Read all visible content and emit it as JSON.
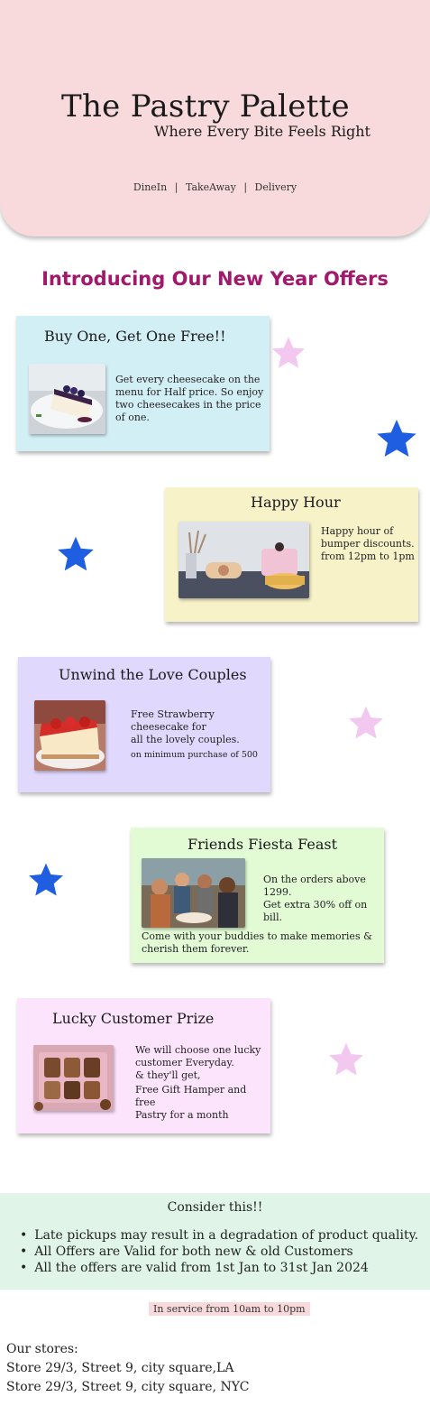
{
  "header": {
    "brand": "The Pastry Palette",
    "tagline": "Where Every Bite Feels Right",
    "services": [
      "DineIn",
      "TakeAway",
      "Delivery"
    ],
    "separator": "|",
    "background_color": "#f8dadc"
  },
  "offers": {
    "title": "Introducing Our New Year Offers",
    "title_color": "#a2196c",
    "cards": [
      {
        "title": "Buy One, Get One Free!!",
        "lines": [
          "Get every cheesecake on the",
          "menu for Half price. So enjoy",
          "two cheesecakes in the price",
          "of one."
        ],
        "image": "blueberry-cheesecake-image",
        "background": "#d3eff6"
      },
      {
        "title": "Happy Hour",
        "lines": [
          "Happy hour of",
          "bumper discounts.",
          "from 12pm to 1pm"
        ],
        "image": "cake-table-image",
        "background": "#f7f2c8"
      },
      {
        "title": "Unwind the Love Couples",
        "lines": [
          "Free Strawberry",
          "cheesecake for",
          "all the lovely couples."
        ],
        "note": "on minimum purchase of 500",
        "image": "strawberry-cheesecake-image",
        "background": "#e1d9fd"
      },
      {
        "title": "Friends Fiesta Feast",
        "lines": [
          "On the orders above",
          "1299.",
          "Get extra 30% off on",
          "bill."
        ],
        "extra_lines": [
          "Come with your buddies to make memories &",
          "cherish them forever."
        ],
        "image": "friends-dining-image",
        "background": "#e2fbd5"
      },
      {
        "title": "Lucky Customer Prize",
        "lines": [
          "We will choose one lucky",
          "customer Everyday.",
          "& they'll get,",
          "Free Gift Hamper and free",
          "Pastry for a month"
        ],
        "image": "gift-hamper-image",
        "background": "#fde4fd"
      }
    ]
  },
  "decorations": {
    "star_blue": "#1f5ee0",
    "star_pink": "#f3c8f0",
    "star_icon": "star-icon"
  },
  "consider": {
    "heading": "Consider this!!",
    "items": [
      "Late pickups may result in a degradation of product quality.",
      "All Offers are Valid for both new & old Customers",
      "All the offers are valid from 1st Jan to 31st Jan 2024"
    ],
    "background": "#e0f5e8"
  },
  "hours": "In service from 10am to 10pm",
  "stores": {
    "heading": "Our stores:",
    "items": [
      "Store 29/3, Street 9, city square,LA",
      "Store 29/3, Street 9, city square, NYC"
    ]
  }
}
